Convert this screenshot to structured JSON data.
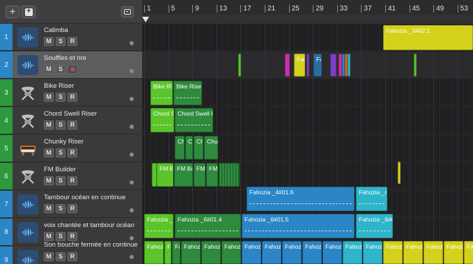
{
  "toolbar": {
    "add_label": "+",
    "duplicate_icon": "duplicate-track-icon",
    "global_tracks_icon": "global-tracks-icon"
  },
  "ruler": {
    "bars": [
      "1",
      "5",
      "9",
      "13",
      "17",
      "21",
      "25",
      "29",
      "33",
      "37",
      "41",
      "45",
      "49",
      "53"
    ]
  },
  "tracks": [
    {
      "number": "1",
      "name": "Calimba",
      "icon": "audio-waveform-icon",
      "m": "M",
      "s": "S",
      "r": "R",
      "armed": false
    },
    {
      "number": "2",
      "name": "Souffles et rire",
      "icon": "audio-waveform-icon",
      "m": "M",
      "s": "S",
      "r": "R",
      "armed": true
    },
    {
      "number": "3",
      "name": "Bike Riser",
      "icon": "drum-kit-icon",
      "m": "M",
      "s": "S",
      "r": "R",
      "armed": false
    },
    {
      "number": "4",
      "name": "Chord Swell Riser",
      "icon": "drum-kit-icon",
      "m": "M",
      "s": "S",
      "r": "R",
      "armed": false
    },
    {
      "number": "5",
      "name": "Chunky Riser",
      "icon": "synth-keyboard-icon",
      "m": "M",
      "s": "S",
      "r": "R",
      "armed": false
    },
    {
      "number": "6",
      "name": "FM Builder",
      "icon": "drum-kit-icon",
      "m": "M",
      "s": "S",
      "r": "R",
      "armed": false
    },
    {
      "number": "7",
      "name": "Tambour océan en continue",
      "icon": "audio-waveform-icon",
      "m": "M",
      "s": "S",
      "r": "R",
      "armed": false
    },
    {
      "number": "8",
      "name": "voix chantée et tambour océan",
      "icon": "audio-waveform-icon",
      "m": "M",
      "s": "S",
      "r": "R",
      "armed": false
    },
    {
      "number": "9",
      "name": "Son bouche fermée en continue",
      "icon": "audio-waveform-icon",
      "m": "M",
      "s": "S",
      "r": "R",
      "armed": false
    }
  ],
  "regions": {
    "r1_calimba": "Fahozia _3#02.1",
    "r3_a": "Bike Ris",
    "r3_b": "Bike Riser",
    "r4_a": "Chord S",
    "r4_b": "Chord Swell R",
    "r5_a": "Ch",
    "r5_b": "C",
    "r5_c": "Ch",
    "r5_d": "Chu",
    "r6_a": "FM Bu",
    "r6_b": "FM Bu",
    "r6_c": "FM",
    "r6_d": "FM",
    "r7_a": "Fahozia _4#01.6",
    "r7_b": "Fahozia _4#",
    "r8_a": "Fahozia _6",
    "r8_b": "Fahozia _6#01.4",
    "r8_c": "Fahozia _6#01.5",
    "r8_d": "Fahozia _6#01.",
    "r2_a": "Fah",
    "r2_b": "Fa",
    "r9_labels": [
      "Fahozi",
      "Fa",
      "Fa",
      "Fahozi",
      "Fahozi",
      "Fahozi",
      "Fahozi",
      "Fahozi",
      "Fahozi",
      "Fahozi",
      "Fahozi",
      "Fahozi",
      "Fahozi",
      "Fahozi",
      "Fahozi",
      "Fahozi",
      "Fahozi",
      "Fahozi"
    ]
  },
  "colors": {
    "green_bright": "#5bc52b",
    "green_dark": "#2e8a3d",
    "blue": "#2a86c6",
    "cyan": "#2fb5c9",
    "yellow": "#d4d11c",
    "magenta": "#cc2fa9",
    "purple": "#7a3fc2",
    "record": "#e2363f"
  }
}
